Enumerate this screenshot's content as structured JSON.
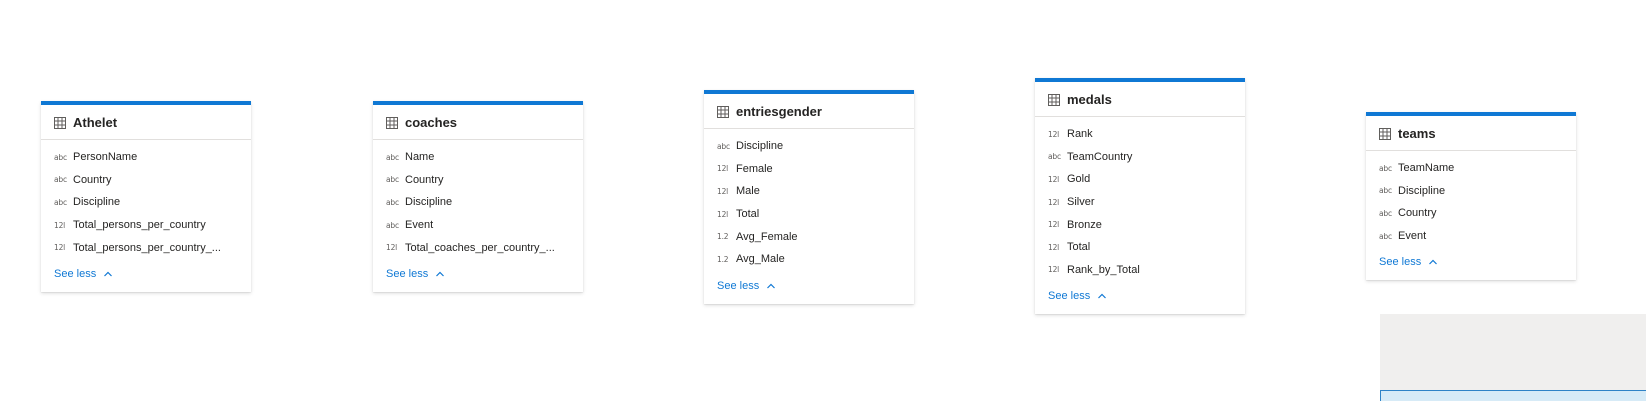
{
  "tables": [
    {
      "title": "Athelet",
      "see_less": "See less",
      "fields": [
        {
          "type": "abc",
          "name": "PersonName"
        },
        {
          "type": "abc",
          "name": "Country"
        },
        {
          "type": "abc",
          "name": "Discipline"
        },
        {
          "type": "12l",
          "name": "Total_persons_per_country"
        },
        {
          "type": "12l",
          "name": "Total_persons_per_country_..."
        }
      ]
    },
    {
      "title": "coaches",
      "see_less": "See less",
      "fields": [
        {
          "type": "abc",
          "name": "Name"
        },
        {
          "type": "abc",
          "name": "Country"
        },
        {
          "type": "abc",
          "name": "Discipline"
        },
        {
          "type": "abc",
          "name": "Event"
        },
        {
          "type": "12l",
          "name": "Total_coaches_per_country_..."
        }
      ]
    },
    {
      "title": "entriesgender",
      "see_less": "See less",
      "fields": [
        {
          "type": "abc",
          "name": "Discipline"
        },
        {
          "type": "12l",
          "name": "Female"
        },
        {
          "type": "12l",
          "name": "Male"
        },
        {
          "type": "12l",
          "name": "Total"
        },
        {
          "type": "1.2",
          "name": "Avg_Female"
        },
        {
          "type": "1.2",
          "name": "Avg_Male"
        }
      ]
    },
    {
      "title": "medals",
      "see_less": "See less",
      "fields": [
        {
          "type": "12l",
          "name": "Rank"
        },
        {
          "type": "abc",
          "name": "TeamCountry"
        },
        {
          "type": "12l",
          "name": "Gold"
        },
        {
          "type": "12l",
          "name": "Silver"
        },
        {
          "type": "12l",
          "name": "Bronze"
        },
        {
          "type": "12l",
          "name": "Total"
        },
        {
          "type": "12l",
          "name": "Rank_by_Total"
        }
      ]
    },
    {
      "title": "teams",
      "see_less": "See less",
      "fields": [
        {
          "type": "abc",
          "name": "TeamName"
        },
        {
          "type": "abc",
          "name": "Discipline"
        },
        {
          "type": "abc",
          "name": "Country"
        },
        {
          "type": "abc",
          "name": "Event"
        }
      ]
    }
  ],
  "colors": {
    "accent": "#0f78d4",
    "text": "#252423",
    "divider": "#e1dfdd"
  }
}
